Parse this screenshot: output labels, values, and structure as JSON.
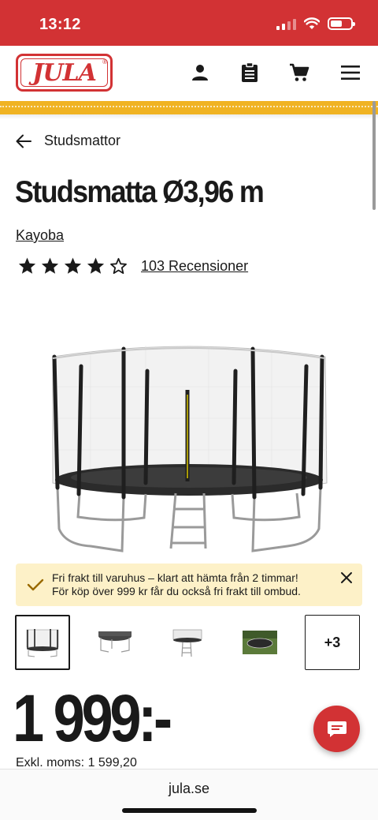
{
  "status_bar": {
    "time": "13:12"
  },
  "header": {
    "logo_text": "JULA",
    "icons": [
      "account-icon",
      "shopping-list-icon",
      "cart-icon",
      "menu-icon"
    ],
    "accent_color": "#d23234",
    "stripe_color": "#f0b323"
  },
  "breadcrumb": {
    "label": "Studsmattor"
  },
  "product": {
    "title": "Studsmatta Ø3,96 m",
    "brand": "Kayoba",
    "rating": {
      "stars_filled": 4,
      "stars_total": 5,
      "reviews_label": "103 Recensioner"
    }
  },
  "notice": {
    "line1": "Fri frakt till varuhus – klart att hämta från 2 timmar!",
    "line2": "För köp över 999 kr får du också fri frakt till ombud.",
    "background": "#fdf1c8"
  },
  "thumbnails": {
    "count_visible": 4,
    "more_label": "+3"
  },
  "price": {
    "value": "1 999:-",
    "vat_label": "Exkl. moms: 1 599,20"
  },
  "browser": {
    "url": "jula.se"
  }
}
